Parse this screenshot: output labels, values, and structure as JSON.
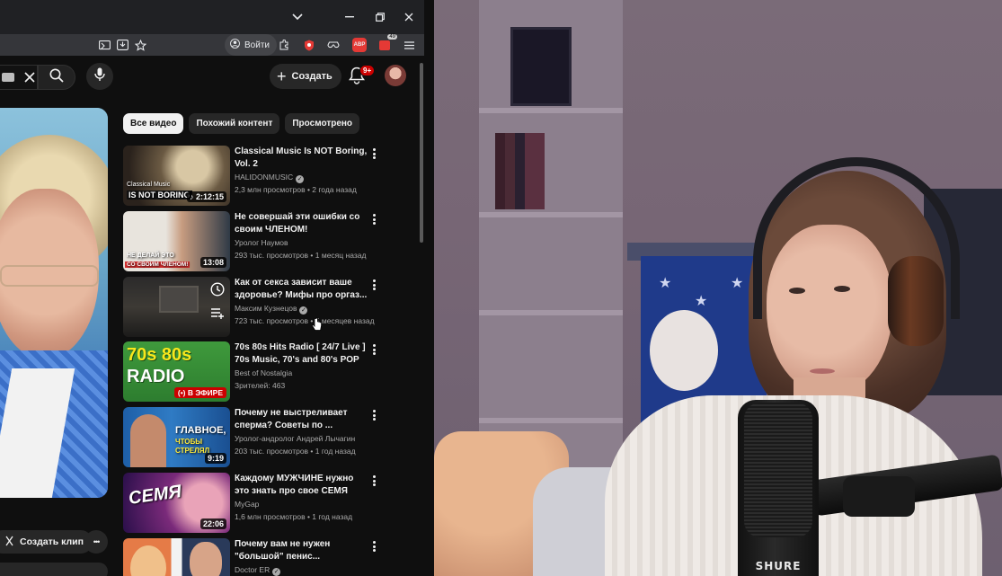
{
  "browser": {
    "toolbar": {
      "login_label": "Войти",
      "ext_badge_abp": "ABP",
      "ext_badge_count": "49"
    }
  },
  "youtube": {
    "header": {
      "create_label": "Создать",
      "notifications_count": "9+"
    },
    "player": {
      "create_clip_label": "Создать клип",
      "more_label": "•••"
    },
    "chips": [
      {
        "label": "Все видео",
        "active": true
      },
      {
        "label": "Похожий контент",
        "active": false
      },
      {
        "label": "Просмотрено",
        "active": false
      }
    ],
    "recommendations": [
      {
        "title": "Classical Music Is NOT Boring, Vol. 2",
        "channel": "HALIDONMUSIC",
        "verified": true,
        "meta": "2,3 млн просмотров • 2 года назад",
        "duration": "2:12:15",
        "thumb_text": "IS NOT BORING",
        "thumb_small": "Classical Music"
      },
      {
        "title": "Не совершай эти ошибки со своим ЧЛЕНОМ!",
        "channel": "Уролог Наумов",
        "verified": false,
        "meta": "293 тыс. просмотров • 1 месяц назад",
        "duration": "13:08",
        "thumb_text": "НЕ ДЕЛАЙ ЭТО",
        "thumb_small": "СО СВОИМ ЧЛЕНОМ!"
      },
      {
        "title": "Как от секса зависит ваше здоровье? Мифы про оргаз...",
        "channel": "Максим Кузнецов",
        "verified": true,
        "meta": "723 тыс. просмотров • 5 месяцев назад",
        "duration": "",
        "thumb_text": "",
        "thumb_small": ""
      },
      {
        "title": "70s 80s Hits Radio [ 24/7 Live ] 70s Music, 70's and 80's POP •...",
        "channel": "Best of Nostalgia",
        "verified": false,
        "meta": "Зрителей: 463",
        "live_label": "В ЭФИРЕ",
        "thumb_text": "70s 80s",
        "thumb_small": "RADIO"
      },
      {
        "title": "Почему не выстреливает сперма? Советы по ...",
        "channel": "Уролог-андролог Андрей Лычагин",
        "verified": false,
        "meta": "203 тыс. просмотров • 1 год назад",
        "duration": "9:19",
        "thumb_text": "ГЛАВНОЕ,",
        "thumb_small": "ЧТОБЫ СТРЕЛЯЛ"
      },
      {
        "title": "Каждому МУЖЧИНЕ нужно это знать про свое СЕМЯ",
        "channel": "MyGap",
        "verified": false,
        "meta": "1,6 млн просмотров • 1 год назад",
        "duration": "22:06",
        "thumb_text": "СЕМЯ",
        "thumb_small": ""
      },
      {
        "title": "Почему вам не нужен \"большой\" пенис...",
        "channel": "Doctor ER",
        "verified": true,
        "meta": "",
        "duration": "",
        "thumb_text": "",
        "thumb_small": ""
      }
    ]
  },
  "webcam": {
    "mic_brand": "SHURE"
  },
  "colors": {
    "yt_bg": "#0f0f0f",
    "chip_bg": "#272727",
    "live_red": "#cc0000",
    "notif_red": "#cc0000"
  }
}
